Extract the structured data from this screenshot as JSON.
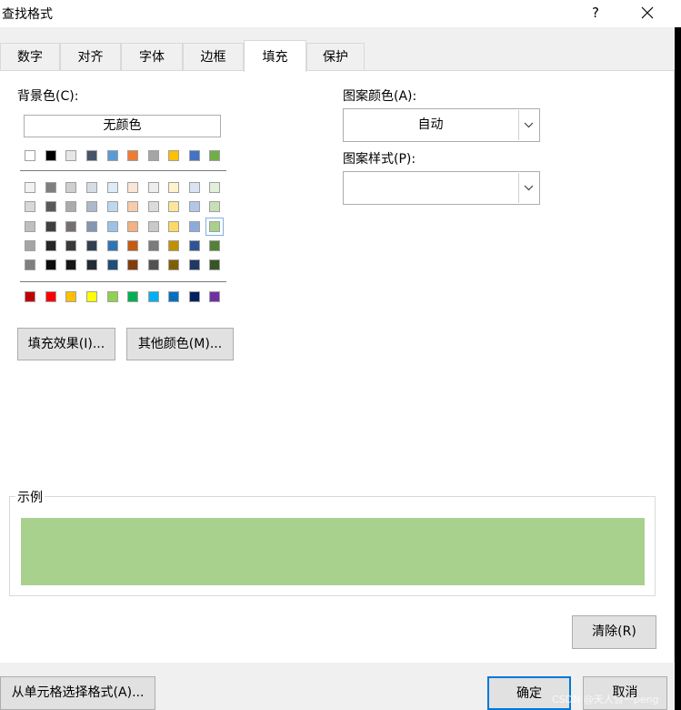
{
  "window": {
    "title": "查找格式",
    "help_label": "?"
  },
  "tabs": [
    {
      "label": "数字",
      "active": false
    },
    {
      "label": "对齐",
      "active": false
    },
    {
      "label": "字体",
      "active": false
    },
    {
      "label": "边框",
      "active": false
    },
    {
      "label": "填充",
      "active": true
    },
    {
      "label": "保护",
      "active": false
    }
  ],
  "fill": {
    "background_label": "背景色(C):",
    "no_color_label": "无颜色",
    "standard_row": [
      "#ffffff",
      "#000000",
      "#e7e6e6",
      "#44546a",
      "#5b9bd5",
      "#ed7d31",
      "#a5a5a5",
      "#ffc000",
      "#4472c4",
      "#70ad47"
    ],
    "shade_rows": [
      [
        "#f2f2f2",
        "#7f7f7f",
        "#d0cece",
        "#d6dce4",
        "#deebf6",
        "#fbe5d5",
        "#ededed",
        "#fff2cc",
        "#dae3f3",
        "#e2efd9"
      ],
      [
        "#d8d8d8",
        "#595959",
        "#aeabab",
        "#adb9ca",
        "#bdd7ee",
        "#f7cbac",
        "#dbdbdb",
        "#fee599",
        "#b4c6e7",
        "#c5e0b3"
      ],
      [
        "#bfbfbf",
        "#3f3f3f",
        "#757070",
        "#8496b0",
        "#9cc3e5",
        "#f4b183",
        "#c9c9c9",
        "#ffd965",
        "#8eaadb",
        "#a9d18e"
      ],
      [
        "#a5a5a5",
        "#262626",
        "#3a3838",
        "#333f4f",
        "#2e75b5",
        "#c55a11",
        "#7b7b7b",
        "#bf9000",
        "#2f5496",
        "#538135"
      ],
      [
        "#7f7f7f",
        "#0c0c0c",
        "#171616",
        "#222a35",
        "#1e4e79",
        "#833c0b",
        "#525252",
        "#7f6000",
        "#1f3864",
        "#375623"
      ]
    ],
    "accent_row": [
      "#c00000",
      "#ff0000",
      "#ffc000",
      "#ffff00",
      "#92d050",
      "#00b050",
      "#00b0f0",
      "#0070c0",
      "#002060",
      "#7030a0"
    ],
    "selected_color": "#a9d18e",
    "fill_effects_label": "填充效果(I)...",
    "more_colors_label": "其他颜色(M)...",
    "pattern_color_label": "图案颜色(A):",
    "pattern_color_value": "自动",
    "pattern_style_label": "图案样式(P):",
    "pattern_style_value": ""
  },
  "sample": {
    "label": "示例",
    "color": "#a9d18e"
  },
  "buttons": {
    "clear": "清除(R)",
    "pick_from_cell": "从单元格选择格式(A)...",
    "ok": "确定",
    "cancel": "取消"
  },
  "watermark": "CSDN @天人合一peng"
}
